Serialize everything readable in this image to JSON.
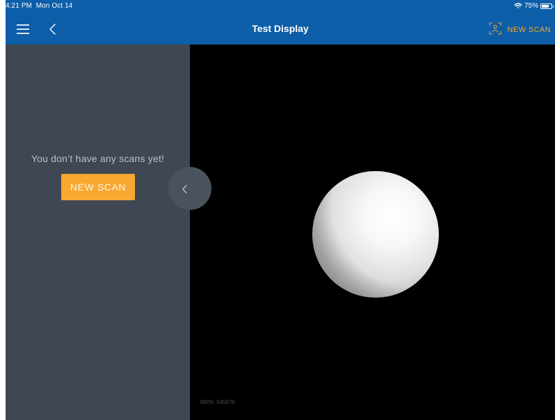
{
  "status_bar": {
    "time": "4:21 PM",
    "date": "Mon Oct 14",
    "battery_text": "75%",
    "battery_level": 0.75,
    "wifi_icon": "wifi-icon",
    "battery_icon": "battery-icon"
  },
  "nav": {
    "title": "Test Display",
    "menu_icon": "hamburger-menu-icon",
    "back_icon": "chevron-left-icon",
    "new_scan_icon": "scan-frame-icon",
    "new_scan_label": "NEW SCAN"
  },
  "sidebar": {
    "empty_message": "You don’t have any scans yet!",
    "new_scan_button": "NEW SCAN",
    "collapse_icon": "chevron-left-icon"
  },
  "viewer": {
    "mrn": "MRN: 345678"
  },
  "colors": {
    "nav_background": "#0d5ea8",
    "accent": "#f7a830",
    "sidebar_background": "#3f4852",
    "viewer_background": "#000000"
  }
}
